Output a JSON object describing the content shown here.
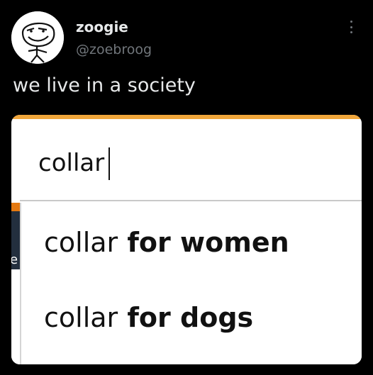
{
  "tweet": {
    "display_name": "zoogie",
    "handle": "@zoebroog",
    "text": "we live in a society",
    "avatar_icon": "troll-face-drawing"
  },
  "search_widget": {
    "query": "collar",
    "accent_color": "#f0a63b",
    "left_strip_glyph": "e",
    "suggestions": [
      {
        "prefix": "collar",
        "completion": " for women"
      },
      {
        "prefix": "collar",
        "completion": " for dogs"
      }
    ]
  }
}
